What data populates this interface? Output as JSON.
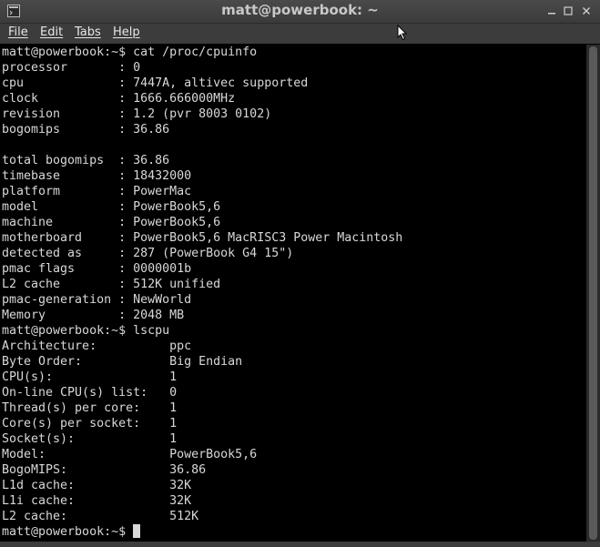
{
  "window": {
    "title": "matt@powerbook: ~",
    "controls": [
      "minimize",
      "maximize",
      "close"
    ]
  },
  "menubar": {
    "items": [
      {
        "label": "File"
      },
      {
        "label": "Edit"
      },
      {
        "label": "Tabs"
      },
      {
        "label": "Help"
      }
    ]
  },
  "terminal": {
    "lines": [
      "matt@powerbook:~$ cat /proc/cpuinfo",
      "processor       : 0",
      "cpu             : 7447A, altivec supported",
      "clock           : 1666.666000MHz",
      "revision        : 1.2 (pvr 8003 0102)",
      "bogomips        : 36.86",
      "",
      "total bogomips  : 36.86",
      "timebase        : 18432000",
      "platform        : PowerMac",
      "model           : PowerBook5,6",
      "machine         : PowerBook5,6",
      "motherboard     : PowerBook5,6 MacRISC3 Power Macintosh",
      "detected as     : 287 (PowerBook G4 15\")",
      "pmac flags      : 0000001b",
      "L2 cache        : 512K unified",
      "pmac-generation : NewWorld",
      "Memory          : 2048 MB",
      "matt@powerbook:~$ lscpu",
      "Architecture:          ppc",
      "Byte Order:            Big Endian",
      "CPU(s):                1",
      "On-line CPU(s) list:   0",
      "Thread(s) per core:    1",
      "Core(s) per socket:    1",
      "Socket(s):             1",
      "Model:                 PowerBook5,6",
      "BogoMIPS:              36.86",
      "L1d cache:             32K",
      "L1i cache:             32K",
      "L2 cache:              512K"
    ],
    "prompt": "matt@powerbook:~$ "
  }
}
